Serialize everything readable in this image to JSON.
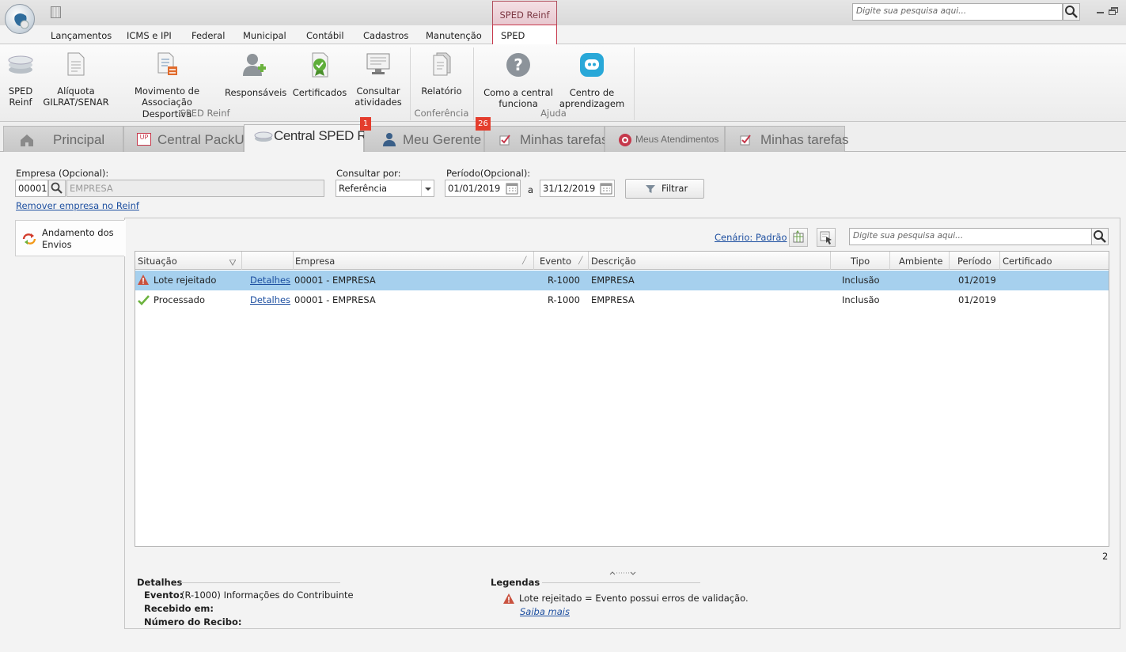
{
  "titlebar": {
    "context_tab": "SPED Reinf",
    "search_placeholder": "Digite sua pesquisa aqui..."
  },
  "menu": {
    "items": [
      "Lançamentos",
      "ICMS e IPI",
      "Federal",
      "Municipal",
      "Contábil",
      "Cadastros",
      "Manutenção"
    ],
    "active": "SPED Reinf"
  },
  "ribbon": {
    "sped_reinf": [
      "SPED\nReinf",
      "Alíquota\nGILRAT/SENAR",
      "Movimento de\nAssociação Desportiva",
      "Responsáveis",
      "Certificados",
      "Consultar\natividades"
    ],
    "conferencia": [
      "Relatório"
    ],
    "ajuda": [
      "Como a central\nfunciona",
      "Centro de\naprendizagem"
    ],
    "groups": [
      "SPED Reinf",
      "Conferência",
      "Ajuda"
    ]
  },
  "doc_tabs": [
    {
      "label": "Principal"
    },
    {
      "label": "Central PackUp",
      "icon_text": "UP"
    },
    {
      "label": "Central SPED Reinf"
    },
    {
      "label": "Meu Gerente",
      "badge": "1"
    },
    {
      "label": "Minhas tarefas",
      "badge": "26"
    },
    {
      "label": "Meus Atendimentos"
    },
    {
      "label": "Minhas tarefas"
    }
  ],
  "filters": {
    "empresa_label": "Empresa (Opcional):",
    "empresa_code": "00001",
    "empresa_name": "EMPRESA",
    "consultar_label": "Consultar por:",
    "consultar_value": "Referência",
    "periodo_label": "Período(Opcional):",
    "date_from": "01/01/2019",
    "date_sep": "a",
    "date_to": "31/12/2019",
    "filter_button": "Filtrar",
    "remove_link": "Remover empresa no Reinf"
  },
  "side_nav": {
    "item": "Andamento dos\nEnvios"
  },
  "grid": {
    "cenario_link": "Cenário: Padrão",
    "search_placeholder": "Digite sua pesquisa aqui...",
    "columns": [
      "Situação",
      "",
      "Empresa",
      "Evento",
      "Descrição",
      "Tipo",
      "Ambiente",
      "Período",
      "Certificado"
    ],
    "rows": [
      {
        "status": "Lote rejeitado",
        "status_kind": "warning",
        "details": "Detalhes",
        "empresa": "00001 - EMPRESA",
        "evento": "R-1000",
        "descricao": "EMPRESA",
        "tipo": "Inclusão",
        "ambiente": "",
        "periodo": "01/2019",
        "certificado": ""
      },
      {
        "status": "Processado",
        "status_kind": "ok",
        "details": "Detalhes",
        "empresa": "00001 - EMPRESA",
        "evento": "R-1000",
        "descricao": "EMPRESA",
        "tipo": "Inclusão",
        "ambiente": "",
        "periodo": "01/2019",
        "certificado": ""
      }
    ],
    "count": "2"
  },
  "details": {
    "title": "Detalhes",
    "evento_label": "Evento:",
    "evento_value": "(R-1000) Informações do Contribuinte",
    "recebido_label": "Recebido em:",
    "recibo_label": "Número do Recibo:"
  },
  "legend": {
    "title": "Legendas",
    "item": "Lote rejeitado = Evento possui erros de validação.",
    "link": "Saiba mais"
  },
  "colors": {
    "selected_row": "#a6d0ee",
    "accent": "#c8394d",
    "badge": "#e43d2d",
    "link": "#1d4fa0"
  }
}
